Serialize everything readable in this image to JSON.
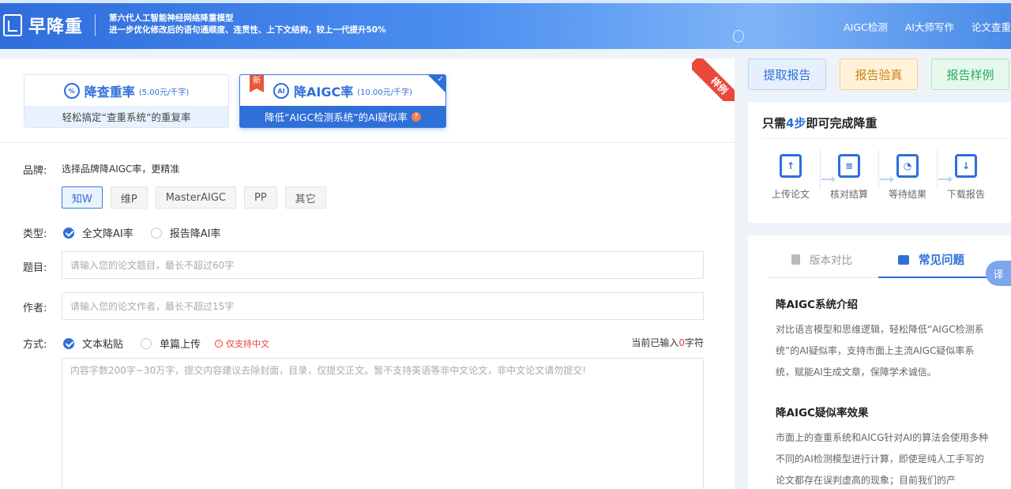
{
  "header": {
    "logo_text": "早降重",
    "tagline_line1": "第六代人工智能神经网络降重模型",
    "tagline_line2": "进一步优化修改后的语句通顺度、连贯性、上下文结构，较上一代提升50%",
    "nav": [
      "AIGC检测",
      "AI大师写作",
      "论文查重"
    ]
  },
  "service_cards": [
    {
      "title": "降查重率",
      "price": "(5.00元/千字)",
      "desc": "轻松搞定“查重系统”的重复率",
      "icon": "percent-icon"
    },
    {
      "title": "降AIGC率",
      "price": "(10.00元/千字)",
      "desc": "降低“AIGC检测系统”的AI疑似率",
      "badge": "新",
      "icon": "ai-icon"
    }
  ],
  "ribbon": "样例",
  "form": {
    "brand_label": "品牌:",
    "brand_hint": "选择品牌降AIGC率，更精准",
    "brands": [
      "知W",
      "维P",
      "MasterAIGC",
      "PP",
      "其它"
    ],
    "brand_selected": "知W",
    "type_label": "类型:",
    "type_options": [
      "全文降AI率",
      "报告降AI率"
    ],
    "type_selected": "全文降AI率",
    "title_label": "题目:",
    "title_placeholder": "请输入您的论文题目，最长不超过60字",
    "author_label": "作者:",
    "author_placeholder": "请输入您的论文作者，最长不超过15字",
    "mode_label": "方式:",
    "mode_options": [
      "文本粘贴",
      "单篇上传"
    ],
    "mode_selected": "文本粘贴",
    "mode_warning": "仅支持中文",
    "counter_prefix": "当前已输入",
    "counter_value": "0",
    "counter_suffix": "字符",
    "content_placeholder": "内容字数200字~30万字，提交内容建议去除封面，目录，仅提交正文。暂不支持英语等非中文论文，非中文论文请勿提交!"
  },
  "actions": [
    "提取报告",
    "报告验真",
    "报告样例"
  ],
  "steps": {
    "title_prefix": "只需",
    "title_num": "4步",
    "title_suffix": "即可完成降重",
    "items": [
      {
        "label": "上传论文",
        "icon": "upload-icon"
      },
      {
        "label": "核对结算",
        "icon": "checkout-icon"
      },
      {
        "label": "等待结果",
        "icon": "clock-icon"
      },
      {
        "label": "下载报告",
        "icon": "download-icon"
      }
    ]
  },
  "faq": {
    "tabs": [
      "版本对比",
      "常见问题"
    ],
    "active_tab": "常见问题",
    "sections": [
      {
        "heading": "降AIGC系统介绍",
        "body": "对比语言模型和思维逻辑，轻松降低“AIGC检测系统”的AI疑似率，支持市面上主流AIGC疑似率系统，赋能AI生成文章，保障学术诚信。"
      },
      {
        "heading": "降AIGC疑似率效果",
        "body": "市面上的查重系统和AICG针对AI的算法会使用多种不同的AI检测模型进行计算，即使是纯人工手写的论文都存在误判虚高的现象；目前我们的产"
      }
    ]
  },
  "translate_label": "译",
  "colors": {
    "primary": "#2f6fd8",
    "warning": "#e5403a",
    "gold": "#c98214",
    "green": "#2aab5e"
  }
}
